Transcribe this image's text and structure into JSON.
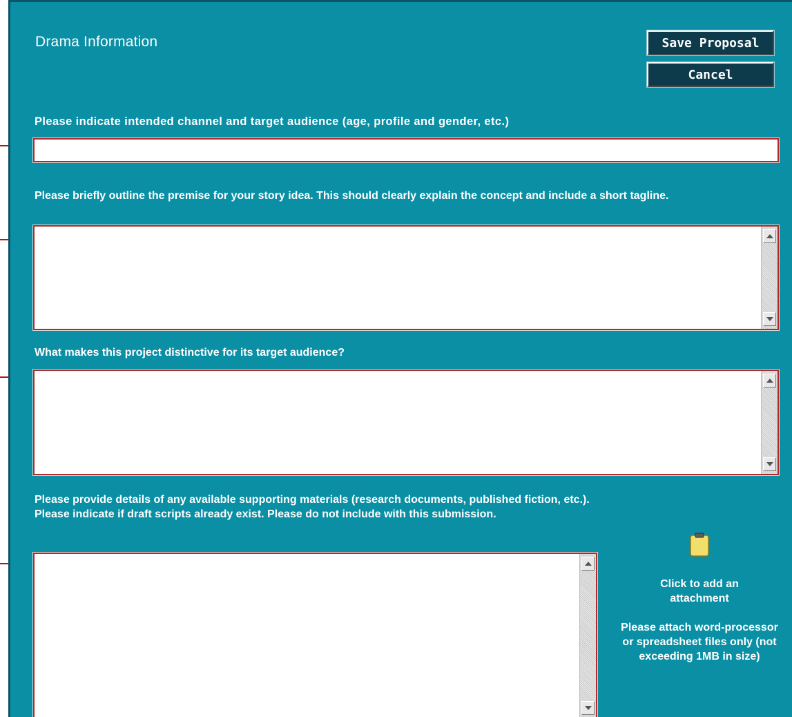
{
  "header": {
    "title": "Drama Information",
    "save_label": "Save Proposal",
    "cancel_label": "Cancel"
  },
  "questions": [
    {
      "label": "Please indicate intended channel and target audience (age, profile and gender, etc.)",
      "value": ""
    },
    {
      "label": "Please briefly outline the premise for your story idea. This should clearly explain the concept and include a short tagline.",
      "value": ""
    },
    {
      "label": "What makes this project distinctive for its target audience?",
      "value": ""
    },
    {
      "label": "Please provide details of any available supporting materials (research documents, published fiction, etc.). Please indicate if draft scripts already exist. Please do not include with this submission.",
      "value": ""
    }
  ],
  "attachment": {
    "icon": "clipboard-icon",
    "click_text": "Click to add an attachment",
    "note": "Please attach word-processor or spreadsheet files only (not exceeding 1MB in size)"
  },
  "colors": {
    "panel_background": "#0a8fa5",
    "button_background": "#0d3b4c",
    "field_border": "#b22a2a",
    "arrow": "#c01010",
    "clipboard": "#f2de6a"
  }
}
